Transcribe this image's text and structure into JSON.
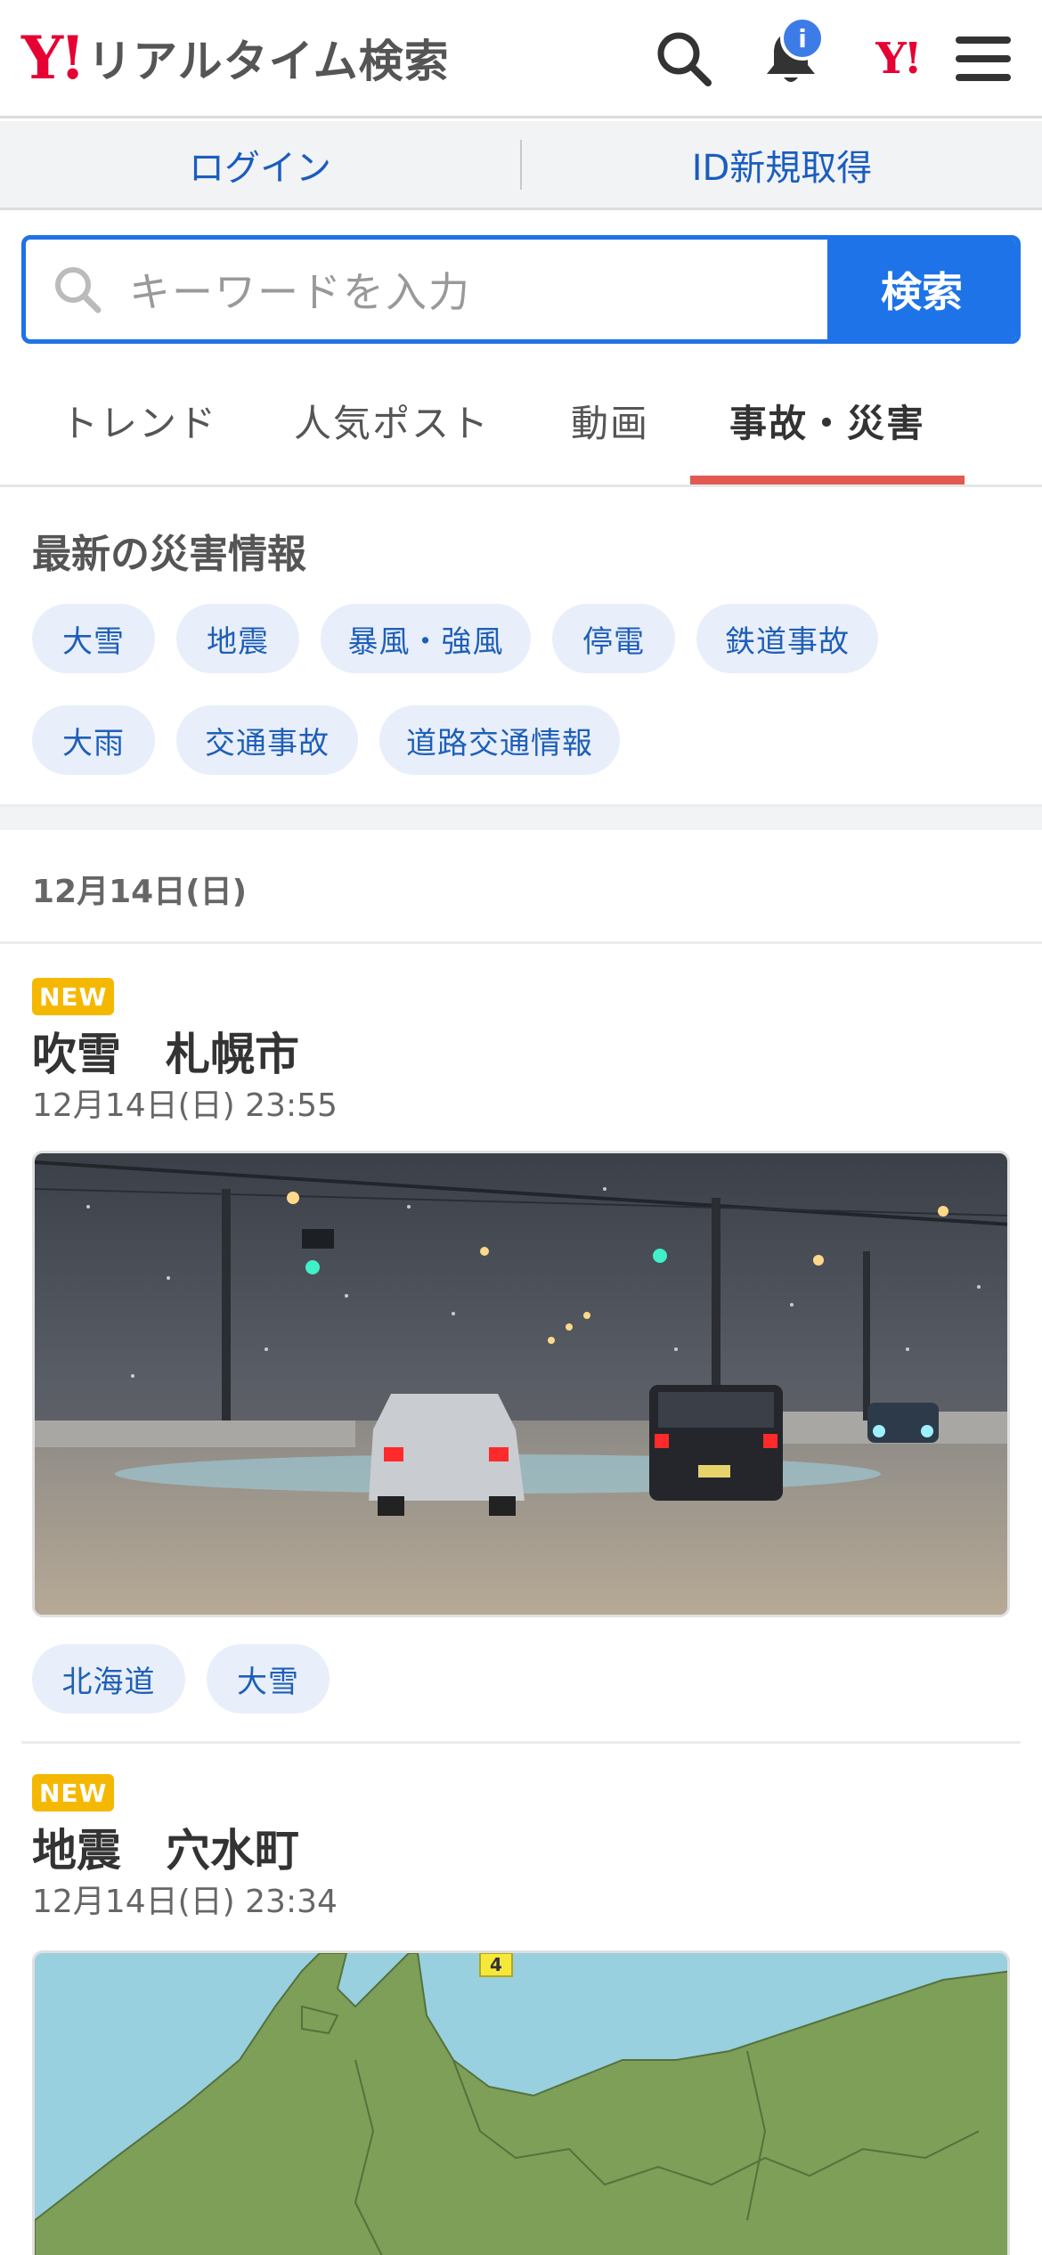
{
  "header": {
    "logo_mark": "Y!",
    "logo_text": "リアルタイム検索",
    "notification_badge": "i",
    "yahoo_mark": "Y!"
  },
  "login_bar": {
    "login": "ログイン",
    "register": "ID新規取得"
  },
  "search": {
    "placeholder": "キーワードを入力",
    "button": "検索"
  },
  "tabs": [
    {
      "label": "トレンド"
    },
    {
      "label": "人気ポスト"
    },
    {
      "label": "動画"
    },
    {
      "label": "事故・災害",
      "active": true
    }
  ],
  "disaster": {
    "title": "最新の災害情報",
    "chips": [
      "大雪",
      "地震",
      "暴風・強風",
      "停電",
      "鉄道事故",
      "大雨",
      "交通事故",
      "道路交通情報"
    ]
  },
  "date_header": "12月14日(日)",
  "posts": [
    {
      "badge": "NEW",
      "title": "吹雪　札幌市",
      "time": "12月14日(日) 23:55",
      "tags": [
        "北海道",
        "大雪"
      ]
    },
    {
      "badge": "NEW",
      "title": "地震　穴水町",
      "time": "12月14日(日) 23:34",
      "map_intensity": "4"
    }
  ],
  "colors": {
    "brand_red": "#e60033",
    "accent_blue": "#1e73e8",
    "chip_bg": "#e8effa",
    "tab_underline": "#e15a52",
    "new_badge": "#f5b800"
  }
}
